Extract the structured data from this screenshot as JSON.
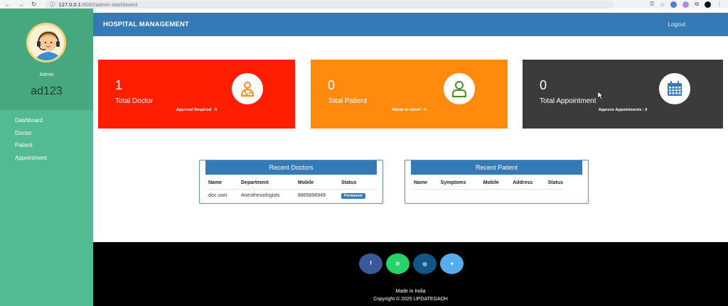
{
  "browser": {
    "host": "127.0.0.1",
    "path": ":8000/admin-dashboard"
  },
  "sidebar": {
    "avatar_label": "Admin",
    "username": "ad123",
    "items": [
      {
        "label": "Dashboard"
      },
      {
        "label": "Doctor"
      },
      {
        "label": "Patient"
      },
      {
        "label": "Appointment"
      }
    ]
  },
  "header": {
    "title": "HOSPITAL MANAGEMENT",
    "logout": "Logout"
  },
  "cards": [
    {
      "count": "1",
      "label": "Total Doctor",
      "sub": "Approval Required : 0",
      "icon": "doctor-icon",
      "color": "#ff1f00"
    },
    {
      "count": "0",
      "label": "Total Patient",
      "sub": "Wards to Admit : 0",
      "icon": "user-icon",
      "color": "#ff8a0d"
    },
    {
      "count": "0",
      "label": "Total Appointment",
      "sub": "Approve Appointments : 0",
      "icon": "calendar-icon",
      "color": "#3b3b3b"
    }
  ],
  "recent_doctors": {
    "title": "Recent Doctors",
    "columns": [
      "Name",
      "Department",
      "Mobile",
      "Status"
    ],
    "rows": [
      {
        "name": "doc user",
        "department": "Anesthesiologists",
        "mobile": "8865898949",
        "status": "Permanent"
      }
    ]
  },
  "recent_patients": {
    "title": "Recent Patient",
    "columns": [
      "Name",
      "Symptoms",
      "Mobile",
      "Address",
      "Status"
    ]
  },
  "footer": {
    "socials": [
      {
        "icon": "facebook-icon",
        "glyph": "f",
        "color": "#3b5998"
      },
      {
        "icon": "whatsapp-icon",
        "glyph": "✆",
        "color": "#25d366"
      },
      {
        "icon": "instagram-icon",
        "glyph": "◎",
        "color": "#125688"
      },
      {
        "icon": "twitter-icon",
        "glyph": "✦",
        "color": "#55acee"
      }
    ],
    "line1": "Made in India",
    "line2": "Copyright © 2025 UPDATEGADH"
  }
}
